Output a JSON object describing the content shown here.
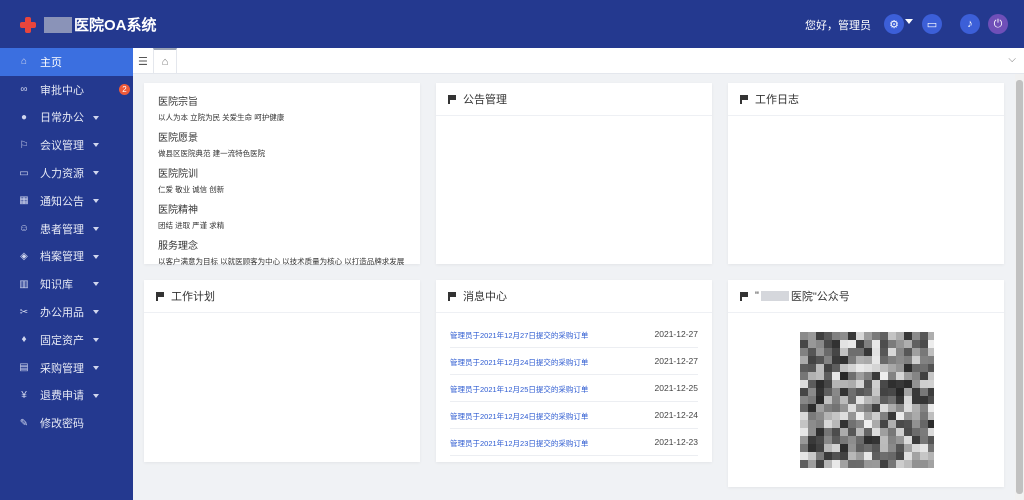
{
  "header": {
    "app_title": "医院OA系统",
    "greeting": "您好，管理员",
    "icons": [
      "settings-icon",
      "message-icon",
      "bell-icon",
      "power-icon"
    ]
  },
  "sidebar": {
    "items": [
      {
        "label": "主页",
        "icon": "home-icon",
        "glyph": "⌂",
        "has_submenu": false,
        "active": true
      },
      {
        "label": "审批中心",
        "icon": "approval-icon",
        "glyph": "∞",
        "has_submenu": false,
        "badge": "2"
      },
      {
        "label": "日常办公",
        "icon": "circle-icon",
        "glyph": "●",
        "has_submenu": true
      },
      {
        "label": "会议管理",
        "icon": "flag-icon",
        "glyph": "⚐",
        "has_submenu": true
      },
      {
        "label": "人力资源",
        "icon": "card-icon",
        "glyph": "▭",
        "has_submenu": true
      },
      {
        "label": "通知公告",
        "icon": "grid-icon",
        "glyph": "▦",
        "has_submenu": true
      },
      {
        "label": "患者管理",
        "icon": "smile-icon",
        "glyph": "☺",
        "has_submenu": true
      },
      {
        "label": "档案管理",
        "icon": "layers-icon",
        "glyph": "◈",
        "has_submenu": true
      },
      {
        "label": "知识库",
        "icon": "book-icon",
        "glyph": "▥",
        "has_submenu": true
      },
      {
        "label": "办公用品",
        "icon": "tools-icon",
        "glyph": "✂",
        "has_submenu": true
      },
      {
        "label": "固定资产",
        "icon": "diamond-icon",
        "glyph": "♦",
        "has_submenu": true
      },
      {
        "label": "采购管理",
        "icon": "list-icon",
        "glyph": "▤",
        "has_submenu": true
      },
      {
        "label": "退费申请",
        "icon": "yen-icon",
        "glyph": "¥",
        "has_submenu": true
      },
      {
        "label": "修改密码",
        "icon": "pencil-icon",
        "glyph": "✎",
        "has_submenu": false
      }
    ]
  },
  "tabs": {
    "home_icon": "home-icon",
    "toggle_icon": "menu-fold-icon",
    "more_icon": "chevron-down-icon"
  },
  "mission": {
    "sections": [
      {
        "title": "医院宗旨",
        "body": "以人为本 立院为民 关爱生命 呵护健康"
      },
      {
        "title": "医院愿景",
        "body": "做县区医院典范 建一流特色医院"
      },
      {
        "title": "医院院训",
        "body": "仁爱 敬业 诚信 创新"
      },
      {
        "title": "医院精神",
        "body": "团结 进取 严谨 求精"
      },
      {
        "title": "服务理念",
        "body": "以客户满意为目标 以就医顾客为中心 以技术质量为核心 以打造品牌求发展"
      }
    ]
  },
  "cards": {
    "notice": "公告管理",
    "worklog": "工作日志",
    "workplan": "工作计划",
    "messages": "消息中心",
    "wechat_prefix": "\"",
    "wechat_suffix": "医院\"公众号"
  },
  "messages": [
    {
      "text": "管理员于2021年12月27日提交的采购订单",
      "date": "2021-12-27"
    },
    {
      "text": "管理员于2021年12月24日提交的采购订单",
      "date": "2021-12-27"
    },
    {
      "text": "管理员于2021年12月25日提交的采购订单",
      "date": "2021-12-25"
    },
    {
      "text": "管理员于2021年12月24日提交的采购订单",
      "date": "2021-12-24"
    },
    {
      "text": "管理员于2021年12月23日提交的采购订单",
      "date": "2021-12-23"
    }
  ],
  "colors": {
    "header": "#24398f",
    "active": "#3b6fe0",
    "link": "#2d5bd1",
    "badge": "#ee5a3a"
  }
}
